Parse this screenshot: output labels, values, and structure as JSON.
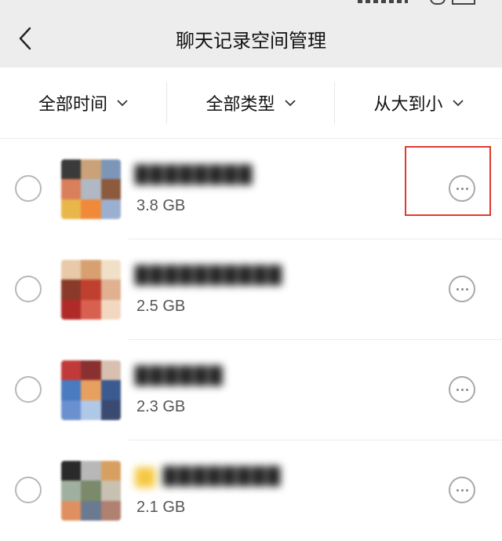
{
  "header": {
    "title": "聊天记录空间管理"
  },
  "filters": [
    {
      "label": "全部时间"
    },
    {
      "label": "全部类型"
    },
    {
      "label": "从大到小"
    }
  ],
  "items": [
    {
      "name": "████████",
      "size": "3.8 GB",
      "has_chip": false
    },
    {
      "name": "██████████",
      "size": "2.5 GB",
      "has_chip": false
    },
    {
      "name": "██████",
      "size": "2.3 GB",
      "has_chip": false
    },
    {
      "name": "████████",
      "size": "2.1 GB",
      "has_chip": true
    }
  ],
  "colors": {
    "nav_bg": "#ededed",
    "highlight": "#e03a2f",
    "chip": "#f5c842"
  },
  "icons": {
    "back": "chevron-left-icon",
    "filter_arrow": "chevron-down-icon",
    "more": "more-horizontal-icon"
  }
}
